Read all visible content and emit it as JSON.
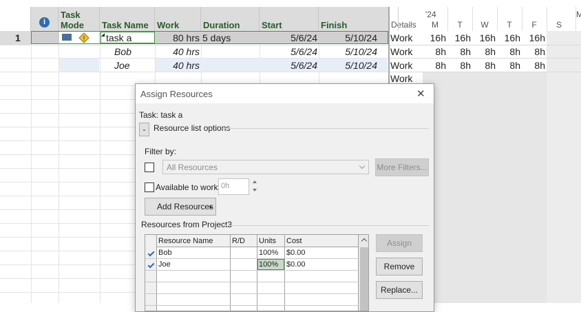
{
  "grid": {
    "headers": {
      "info_icon": "i",
      "task_mode": "Task\nMode",
      "task_name": "Task Name",
      "work": "Work",
      "duration": "Duration",
      "start": "Start",
      "finish": "Finish"
    },
    "rows": [
      {
        "id": "1",
        "name": "task a",
        "work": "80 hrs",
        "duration": "5 days",
        "start": "5/6/24",
        "finish": "5/10/24"
      },
      {
        "id": "",
        "name": "Bob",
        "work": "40 hrs",
        "duration": "",
        "start": "5/6/24",
        "finish": "5/10/24"
      },
      {
        "id": "",
        "name": "Joe",
        "work": "40 hrs",
        "duration": "",
        "start": "5/6/24",
        "finish": "5/10/24"
      }
    ]
  },
  "timescale": {
    "details_label": "Details",
    "year": "'24",
    "next_label": "M",
    "days": [
      "M",
      "T",
      "W",
      "T",
      "F",
      "S"
    ],
    "rows": [
      {
        "label": "Work",
        "values": [
          "16h",
          "16h",
          "16h",
          "16h",
          "16h"
        ]
      },
      {
        "label": "Work",
        "values": [
          "8h",
          "8h",
          "8h",
          "8h",
          "8h"
        ]
      },
      {
        "label": "Work",
        "values": [
          "8h",
          "8h",
          "8h",
          "8h",
          "8h"
        ]
      },
      {
        "label": "Work",
        "values": []
      }
    ]
  },
  "dialog": {
    "title": "Assign Resources",
    "close_glyph": "✕",
    "task_label": "Task: task a",
    "collapse_glyph": "-",
    "resource_list_options": "Resource list options",
    "filter_by": "Filter by:",
    "filter_value": "All Resources",
    "more_filters": "More Filters...",
    "available_to_work": "Available to work",
    "available_value": "0h",
    "add_resources": "Add Resources",
    "resources_from": "Resources from Project3",
    "table_headers": [
      "Resource Name",
      "R/D",
      "Units",
      "Cost"
    ],
    "resources": [
      {
        "name": "Bob",
        "rd": "",
        "units": "100%",
        "cost": "$0.00",
        "assigned": true
      },
      {
        "name": "Joe",
        "rd": "",
        "units": "100%",
        "cost": "$0.00",
        "assigned": true
      }
    ],
    "assign": "Assign",
    "remove": "Remove",
    "replace": "Replace..."
  }
}
